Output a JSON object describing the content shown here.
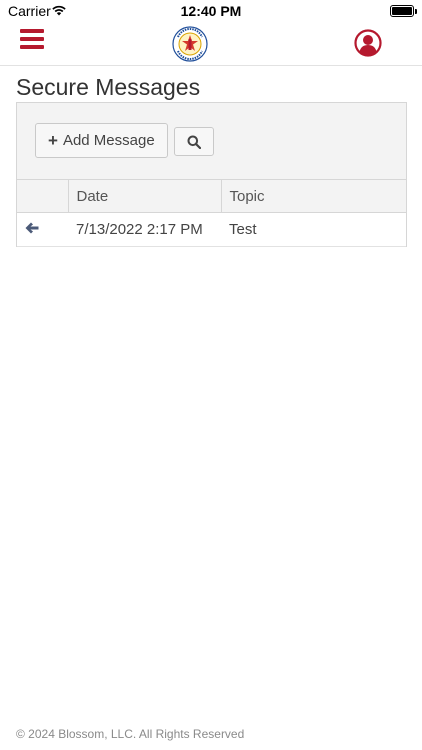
{
  "status_bar": {
    "carrier": "Carrier",
    "time": "12:40 PM"
  },
  "header": {
    "menu_icon": "hamburger-icon",
    "logo_icon": "fire-department-logo",
    "user_icon": "user-account-icon",
    "accent_color": "#b5192e"
  },
  "page": {
    "title": "Secure Messages"
  },
  "toolbar": {
    "add_label": "Add Message",
    "add_icon": "plus-icon",
    "search_icon": "search-icon"
  },
  "table": {
    "columns": [
      "",
      "Date",
      "Topic"
    ],
    "rows": [
      {
        "icon": "left-arrow-icon",
        "date": "7/13/2022 2:17 PM",
        "topic": "Test"
      }
    ]
  },
  "footer": {
    "copyright": "© 2024 Blossom, LLC. All Rights Reserved"
  }
}
